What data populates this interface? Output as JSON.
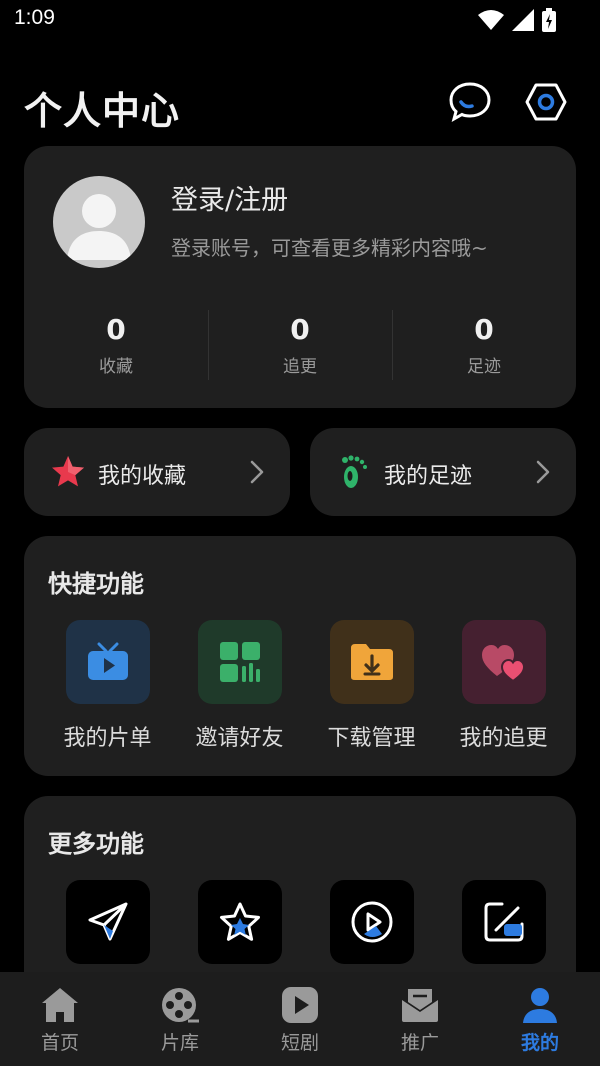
{
  "status_bar": {
    "time": "1:09"
  },
  "header": {
    "title": "个人中心"
  },
  "profile": {
    "login_title": "登录/注册",
    "login_subtitle": "登录账号，可查看更多精彩内容哦~",
    "stats": [
      {
        "value": "0",
        "label": "收藏"
      },
      {
        "value": "0",
        "label": "追更"
      },
      {
        "value": "0",
        "label": "足迹"
      }
    ]
  },
  "shortcuts": [
    {
      "label": "我的收藏",
      "icon": "star-icon"
    },
    {
      "label": "我的足迹",
      "icon": "footprint-icon"
    }
  ],
  "quick_functions": {
    "title": "快捷功能",
    "items": [
      {
        "label": "我的片单",
        "icon": "tv-icon",
        "color": "#3b8de3"
      },
      {
        "label": "邀请好友",
        "icon": "grid-icon",
        "color": "#3bb06a"
      },
      {
        "label": "下载管理",
        "icon": "download-folder-icon",
        "color": "#f0a53a"
      },
      {
        "label": "我的追更",
        "icon": "hearts-icon",
        "color": "#e64d6e"
      }
    ]
  },
  "more_functions": {
    "title": "更多功能",
    "items": [
      {
        "icon": "send-icon"
      },
      {
        "icon": "star-icon"
      },
      {
        "icon": "play-circle-icon"
      },
      {
        "icon": "edit-icon"
      }
    ]
  },
  "tabs": [
    {
      "label": "首页",
      "icon": "home-icon",
      "active": false
    },
    {
      "label": "片库",
      "icon": "film-reel-icon",
      "active": false
    },
    {
      "label": "短剧",
      "icon": "play-icon",
      "active": false
    },
    {
      "label": "推广",
      "icon": "mail-icon",
      "active": false
    },
    {
      "label": "我的",
      "icon": "user-icon",
      "active": true
    }
  ],
  "colors": {
    "accent": "#2d7be0",
    "card": "#1f1f1f",
    "background": "#000000"
  }
}
